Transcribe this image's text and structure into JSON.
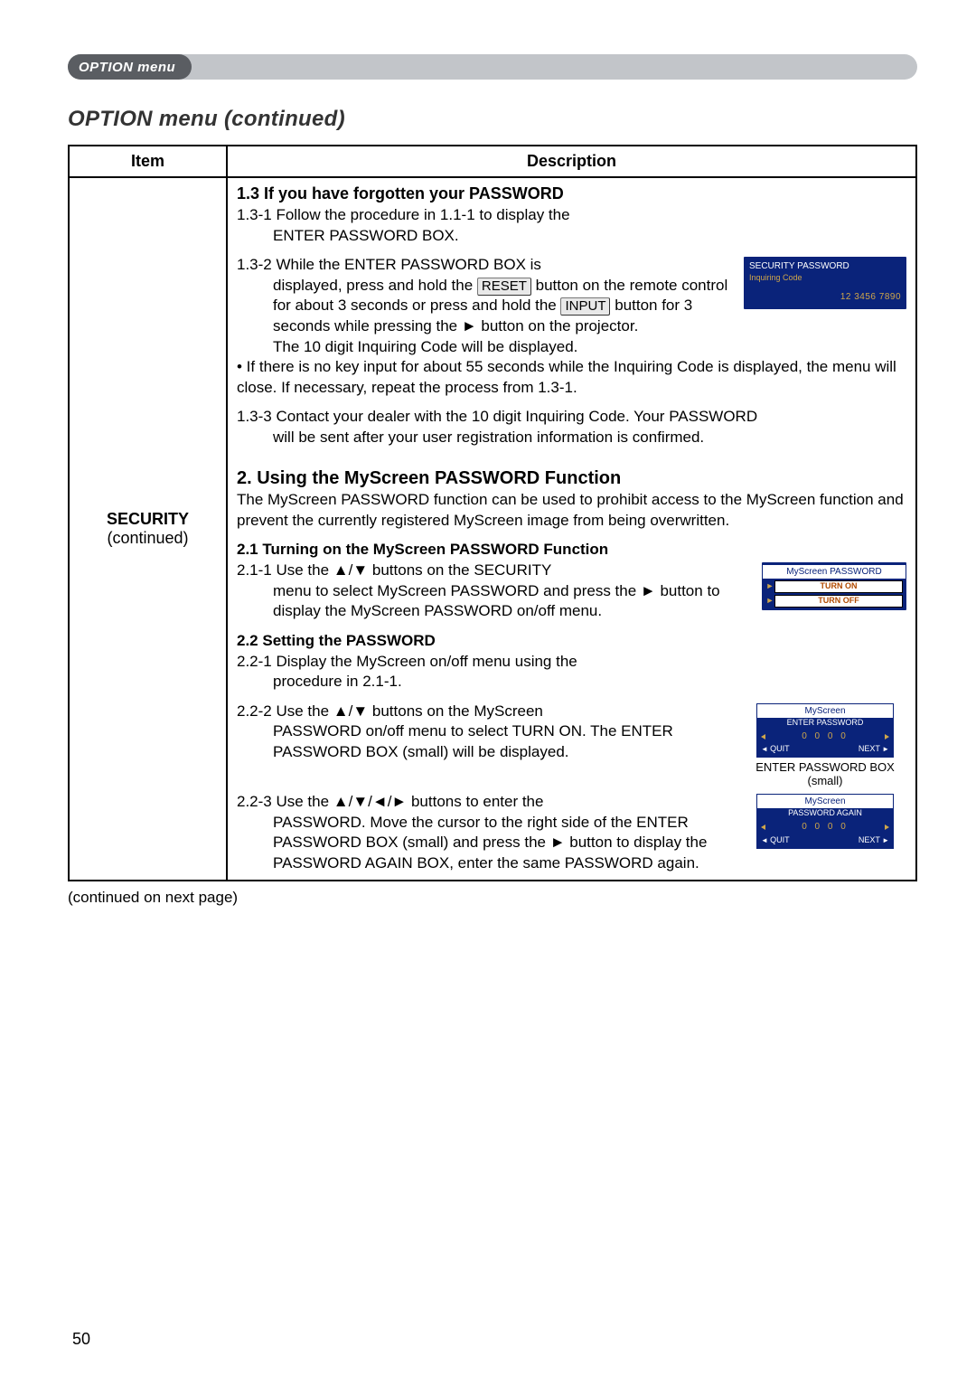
{
  "tab": {
    "label": "OPTION menu"
  },
  "section_title": "OPTION menu (continued)",
  "table": {
    "headers": {
      "item": "Item",
      "description": "Description"
    },
    "item_cell": {
      "title": "SECURITY",
      "subtitle": "(continued)"
    }
  },
  "s13": {
    "title": "1.3 If you have forgotten your PASSWORD",
    "p1a": "1.3-1 Follow the procedure in 1.1-1 to display the",
    "p1b": "ENTER PASSWORD BOX.",
    "p2a": "1.3-2 While the ENTER PASSWORD BOX is",
    "p2b": "displayed, press and hold the ",
    "btn_reset": "RESET",
    "p2c": " button on the remote control for about 3 seconds or press and hold the ",
    "btn_input": "INPUT",
    "p2d": " button for 3 seconds while pressing the ► button on the projector.",
    "p2e": "The 10 digit Inquiring Code will be displayed.",
    "p2f": "• If there is no key input for about 55 seconds while the Inquiring Code is displayed, the menu will close. If necessary, repeat the process from 1.3-1.",
    "p3a": "1.3-3 Contact your dealer with the 10 digit Inquiring Code. Your PASSWORD",
    "p3b": "will be sent after your user registration information is confirmed.",
    "fig": {
      "hdr": "SECURITY PASSWORD",
      "sub": "Inquiring Code",
      "code": "12 3456 7890"
    }
  },
  "s2": {
    "title": "2. Using the MyScreen PASSWORD Function",
    "intro": "The MyScreen PASSWORD function can be used to prohibit access to the MyScreen function and prevent the currently registered MyScreen image from being overwritten."
  },
  "s21": {
    "title": "2.1 Turning on the MyScreen PASSWORD Function",
    "p1a": "2.1-1 Use the ▲/▼ buttons on the SECURITY",
    "p1b": "menu to select MyScreen PASSWORD and press the ► button to display the MyScreen PASSWORD on/off menu.",
    "fig": {
      "title": "MyScreen PASSWORD",
      "opt_on": "TURN ON",
      "opt_off": "TURN OFF"
    }
  },
  "s22": {
    "title": "2.2 Setting the PASSWORD",
    "p1a": "2.2-1 Display the MyScreen on/off menu using the",
    "p1b": "procedure in 2.1-1.",
    "p2a": "2.2-2 Use the ▲/▼ buttons on the MyScreen",
    "p2b": "PASSWORD on/off menu to select TURN ON. The ENTER PASSWORD BOX (small) will be displayed.",
    "p3a": "2.2-3 Use the ▲/▼/◄/► buttons to enter the",
    "p3b": "PASSWORD. Move the cursor to the right side of the ENTER PASSWORD BOX (small) and press the ► button to display the PASSWORD AGAIN BOX, enter the same PASSWORD again.",
    "fig_enter": {
      "t1": "MyScreen",
      "t2": "ENTER PASSWORD",
      "digits": "0 0 0 0",
      "quit": "QUIT",
      "next": "NEXT",
      "caption_a": "ENTER PASSWORD BOX",
      "caption_b": "(small)"
    },
    "fig_again": {
      "t1": "MyScreen",
      "t2": "PASSWORD AGAIN",
      "digits": "0 0 0 0",
      "quit": "QUIT",
      "next": "NEXT"
    }
  },
  "continued_note": "(continued on next page)",
  "page_number": "50"
}
